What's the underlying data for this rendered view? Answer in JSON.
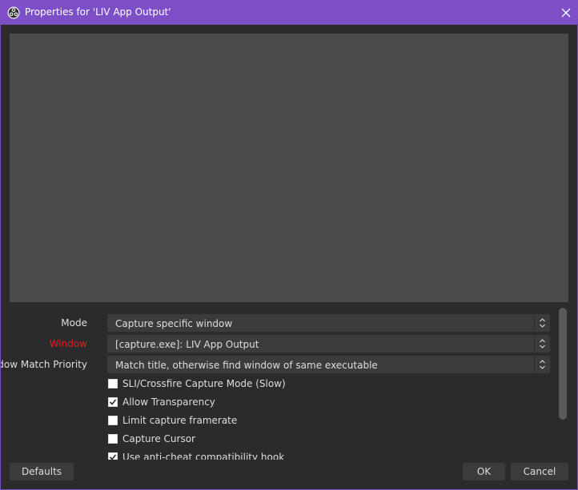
{
  "window": {
    "title": "Properties for 'LIV App Output'"
  },
  "properties": {
    "mode": {
      "label": "Mode",
      "value": "Capture specific window"
    },
    "window_select": {
      "label": "Window",
      "value": "[capture.exe]: LIV App Output"
    },
    "match_priority": {
      "label": "Window Match Priority",
      "value": "Match title, otherwise find window of same executable"
    },
    "checkboxes": [
      {
        "label": "SLI/Crossfire Capture Mode (Slow)",
        "checked": false
      },
      {
        "label": "Allow Transparency",
        "checked": true
      },
      {
        "label": "Limit capture framerate",
        "checked": false
      },
      {
        "label": "Capture Cursor",
        "checked": false
      },
      {
        "label": "Use anti-cheat compatibility hook",
        "checked": true
      }
    ]
  },
  "buttons": {
    "defaults": "Defaults",
    "ok": "OK",
    "cancel": "Cancel"
  },
  "colors": {
    "titlebar": "#7d4fc6",
    "background": "#2b2b2b",
    "preview": "#4a4a4a",
    "error_label": "#e02020"
  }
}
